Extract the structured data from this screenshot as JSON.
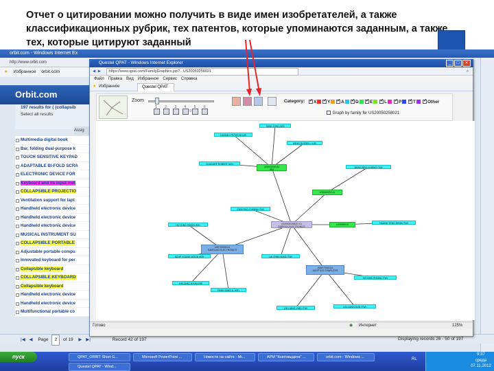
{
  "caption": "Отчет о цитировании можно получить в виде имен изобретателей, а также классификационных рубрик, тех патентов, которые упоминаются заданным, а также тех, которые цитируют заданный",
  "bg_window": {
    "title": "orbit.com - Windows Internet Ex",
    "address": "http://www.orbit.com",
    "fav_label": "Избранное",
    "fav_site": "orbit.com",
    "logo": "Orbit.com",
    "results_heading": "197 results for ( (collapsib",
    "select_all": "Select all results",
    "assign": "Assig",
    "results": [
      {
        "text": "Multimedia digital book",
        "hl": ""
      },
      {
        "text": "Bar, folding dual-purpose k",
        "hl": ""
      },
      {
        "text": "TOUCH SENSITIVE KEYPAD",
        "hl": ""
      },
      {
        "text": "ADAPTABLE BI-FOLD SCRA",
        "hl": ""
      },
      {
        "text": "ELECTRONIC DEVICE FOR",
        "hl": ""
      },
      {
        "text": "Keyboard and its input met",
        "hl": "m"
      },
      {
        "text": "COLLAPSIBLE PROJECTIO",
        "hl": "y"
      },
      {
        "text": "Ventilation support for lapt",
        "hl": ""
      },
      {
        "text": "Handheld electronic device",
        "hl": ""
      },
      {
        "text": "Handheld electronic device",
        "hl": ""
      },
      {
        "text": "Handheld electronic device",
        "hl": ""
      },
      {
        "text": "MUSICAL INSTRUMENT SU",
        "hl": ""
      },
      {
        "text": "COLLAPSIBLE PORTABLE",
        "hl": "y"
      },
      {
        "text": "Adjustable portable compu",
        "hl": ""
      },
      {
        "text": "Innovated keyboard for per",
        "hl": ""
      },
      {
        "text": "Collapsible keyboard",
        "hl": "y"
      },
      {
        "text": "COLLAPSIBLE KEYBOARD",
        "hl": "y"
      },
      {
        "text": "Collapsible keyboard",
        "hl": "y"
      },
      {
        "text": "Handheld electronic device",
        "hl": ""
      },
      {
        "text": "Handheld electronic device",
        "hl": ""
      },
      {
        "text": "Multifunctional portable co",
        "hl": ""
      }
    ],
    "pager": {
      "page_label": "Page",
      "page": "2",
      "of": "of 19",
      "record": "Record 42 of 197",
      "displaying": "Displaying records 26 - 50 of 197",
      "zoom": "125%",
      "internet": "Интернет"
    }
  },
  "popup": {
    "title": "Questel QPAT - Windows Internet Explorer",
    "address": "https://www.qpat.com/FamilyGraphics.jsp?...US20050258021",
    "menu": [
      "Файл",
      "Правка",
      "Вид",
      "Избранное",
      "Сервис",
      "Справка"
    ],
    "fav_label": "Избранное",
    "tab_label": "Questel QPAT",
    "zoom_label": "Zoom",
    "zoom_ticks": "1 2 3 4 5 6 7 8 9 10",
    "category_label": "Category:",
    "categories": [
      {
        "label": "X",
        "on": true,
        "color": "#e8332a"
      },
      {
        "label": "Y",
        "on": true,
        "color": "#e8a12a"
      },
      {
        "label": "A",
        "on": true,
        "color": "#2ac3e8"
      },
      {
        "label": "D",
        "on": true,
        "color": "#2ae84a"
      },
      {
        "label": "E",
        "on": true,
        "color": "#7ae82a"
      },
      {
        "label": "L",
        "on": true,
        "color": "#e82ac3"
      },
      {
        "label": "P",
        "on": true,
        "color": "#2a4be8"
      },
      {
        "label": "T",
        "on": true,
        "color": "#a02ae8"
      },
      {
        "label": "Other",
        "on": true,
        "color": ""
      }
    ],
    "graph_by_family": "Graph by family for US20050258021",
    "status_ready": "Готово",
    "status_internet": "Интернет",
    "status_zoom": "125%"
  },
  "graph": {
    "center": {
      "line1": "US20050258021 A1",
      "line2": "DARFON ELECTRONICS"
    },
    "hubs": [
      {
        "line1": "US5000000 A1",
        "line2": "IBM",
        "color": "gr"
      },
      {
        "line1": "US6860000 A1",
        "line2": "",
        "color": "gr"
      },
      {
        "line1": "US5995025",
        "line2": "",
        "color": "gr"
      },
      {
        "line1": "US6700000 A1",
        "line2": "SAMSUNG ELECTRONICS",
        "color": "bl"
      },
      {
        "line1": "US6070000 A1",
        "line2": "ADOPTER COMPUTER",
        "color": "bl"
      }
    ],
    "inventors": [
      "TANG JOHN (US)",
      "CASSIDY PETER M (US)",
      "MEAD RUSSELL (US)",
      "OLDDORF ROBERT (US)",
      "WANG BEN-CHIENG (TW)",
      "CHIN RUO-CHINNU (TW)",
      "HO JONG-HWON (KR)",
      "HUANG TENG-SHUN (TW)",
      "SEHP YOUNG WOOK (KR)",
      "LAI CHIN-HUNG (TW)",
      "HO DISE-PHONG (TW)",
      "KIM JANG-HYUN (KR)",
      "PARK SANG-IL (KR)",
      "LIN LIANG-YING (TW)",
      "LIN-LIANG-SUN (TW)"
    ]
  },
  "taskbar": {
    "start": "пуск",
    "buttons": [
      "QPAT_ORBIT Short G...",
      "Microsoft PowerPoint ...",
      "Новости на сайте - Mi...",
      "АРМ \"Книговыдача\" ...",
      "orbit.com - Windows ...",
      "Questel QPAT - Wind..."
    ],
    "lang": "RL",
    "time": "9:37",
    "day": "среда",
    "date": "07.11.2012"
  }
}
